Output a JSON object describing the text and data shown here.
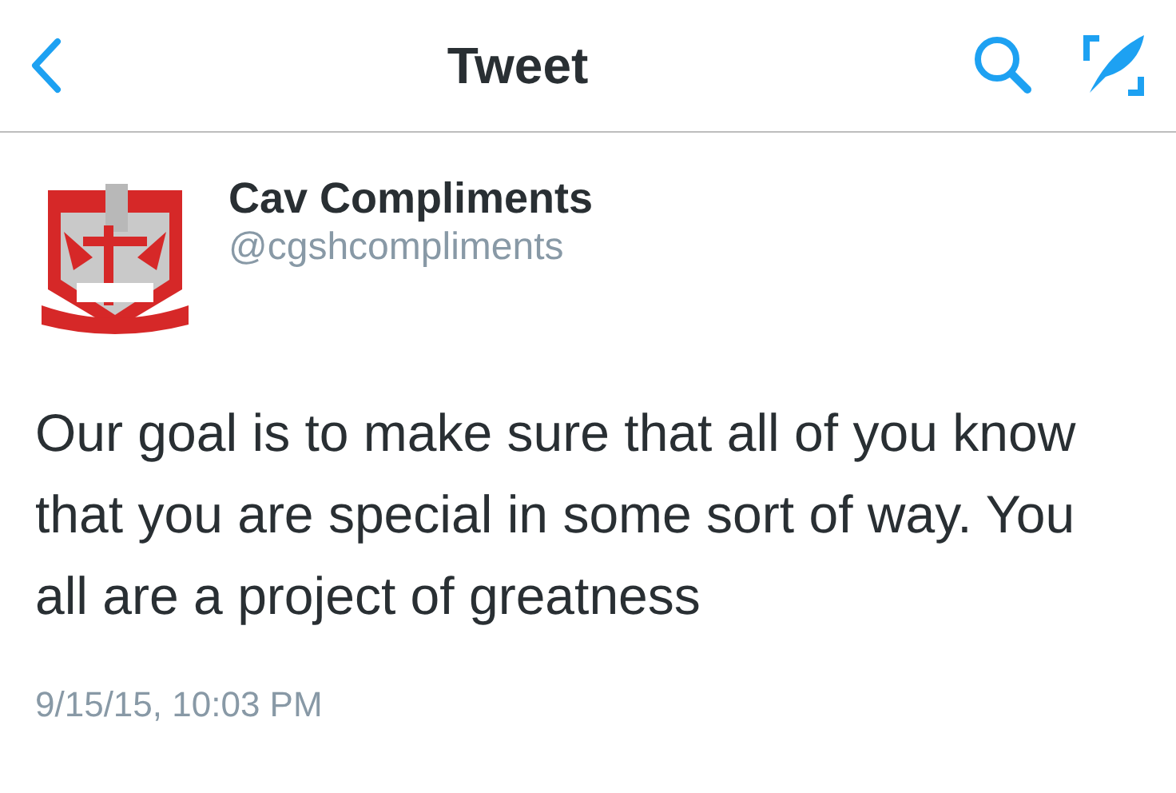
{
  "nav": {
    "title": "Tweet"
  },
  "tweet": {
    "author": "Cav Compliments",
    "handle": "@cgshcompliments",
    "text": "Our goal is to make sure that all of you know that you are special in some sort of way. You all are a project of greatness",
    "timestamp": "9/15/15, 10:03 PM"
  }
}
